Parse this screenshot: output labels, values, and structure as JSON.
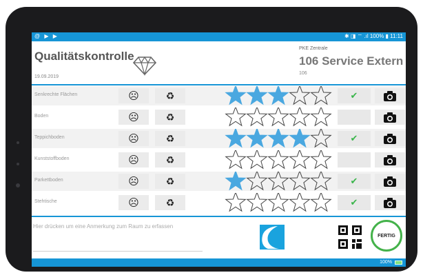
{
  "status_bar": {
    "left_icons": "@ ▶ ▶",
    "right_text": "✱ ◨ ⌔ .ıl 100% ▮ 11:11"
  },
  "header": {
    "app_title": "Qualitätskontrolle",
    "date": "19.09.2019",
    "location": "PKE Zentrale",
    "room_title": "106 Service Extern",
    "room_number": "106"
  },
  "rows": [
    {
      "label": "Senkrechte Flächen",
      "rating": 3,
      "checked": true
    },
    {
      "label": "Boden",
      "rating": 0,
      "checked": false
    },
    {
      "label": "Teppichboden",
      "rating": 4,
      "checked": true
    },
    {
      "label": "Kunststoffboden",
      "rating": 0,
      "checked": false
    },
    {
      "label": "Parkettboden",
      "rating": 1,
      "checked": true
    },
    {
      "label": "Stehtische",
      "rating": 0,
      "checked": true
    }
  ],
  "icons": {
    "sad": "☹",
    "recycle": "♻",
    "check": "✔"
  },
  "note": {
    "placeholder": "Hier drücken um eine Anmerkung zum Raum zu erfassen"
  },
  "done_button": {
    "label": "FERTIG"
  },
  "footer": {
    "battery": "100%"
  },
  "colors": {
    "accent": "#1695d6",
    "star_filled": "#4aa8e0",
    "check_green": "#39b54a",
    "done_ring": "#44b24a"
  }
}
